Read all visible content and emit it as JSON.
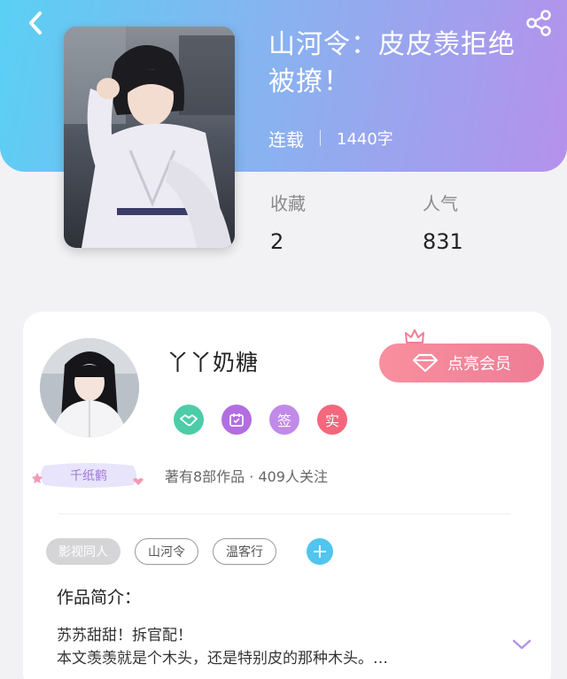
{
  "book": {
    "title": "山河令：皮皮羡拒绝被撩！",
    "status": "连载",
    "word_count": "1440字",
    "stats": {
      "favorites_label": "收藏",
      "favorites_value": "2",
      "popularity_label": "人气",
      "popularity_value": "831"
    }
  },
  "author": {
    "name": "丫丫奶糖",
    "vip_button_label": "点亮会员",
    "level_badge": "千纸鹤",
    "badges": [
      {
        "name": "handshake-badge-icon",
        "text": "",
        "color": "#4ccca8"
      },
      {
        "name": "calendar-badge-icon",
        "text": "",
        "color": "#b26ee0"
      },
      {
        "name": "sign-badge",
        "text": "签",
        "color": "#c18ae8"
      },
      {
        "name": "verified-badge",
        "text": "实",
        "color": "#f4677c"
      }
    ],
    "works_summary": "著有8部作品 · 409人关注"
  },
  "tags": {
    "primary": "影视同人",
    "items": [
      "山河令",
      "温客行"
    ],
    "add_label": "+"
  },
  "intro": {
    "title": "作品简介：",
    "line1": "苏苏甜甜！拆官配！",
    "line2": "本文羡羡就是个木头，还是特别皮的那种木头。…"
  },
  "colors": {
    "header_start": "#5ad0f5",
    "header_end": "#b591ec",
    "vip_pink": "#ee7d95",
    "accent_blue": "#50c5ee"
  }
}
